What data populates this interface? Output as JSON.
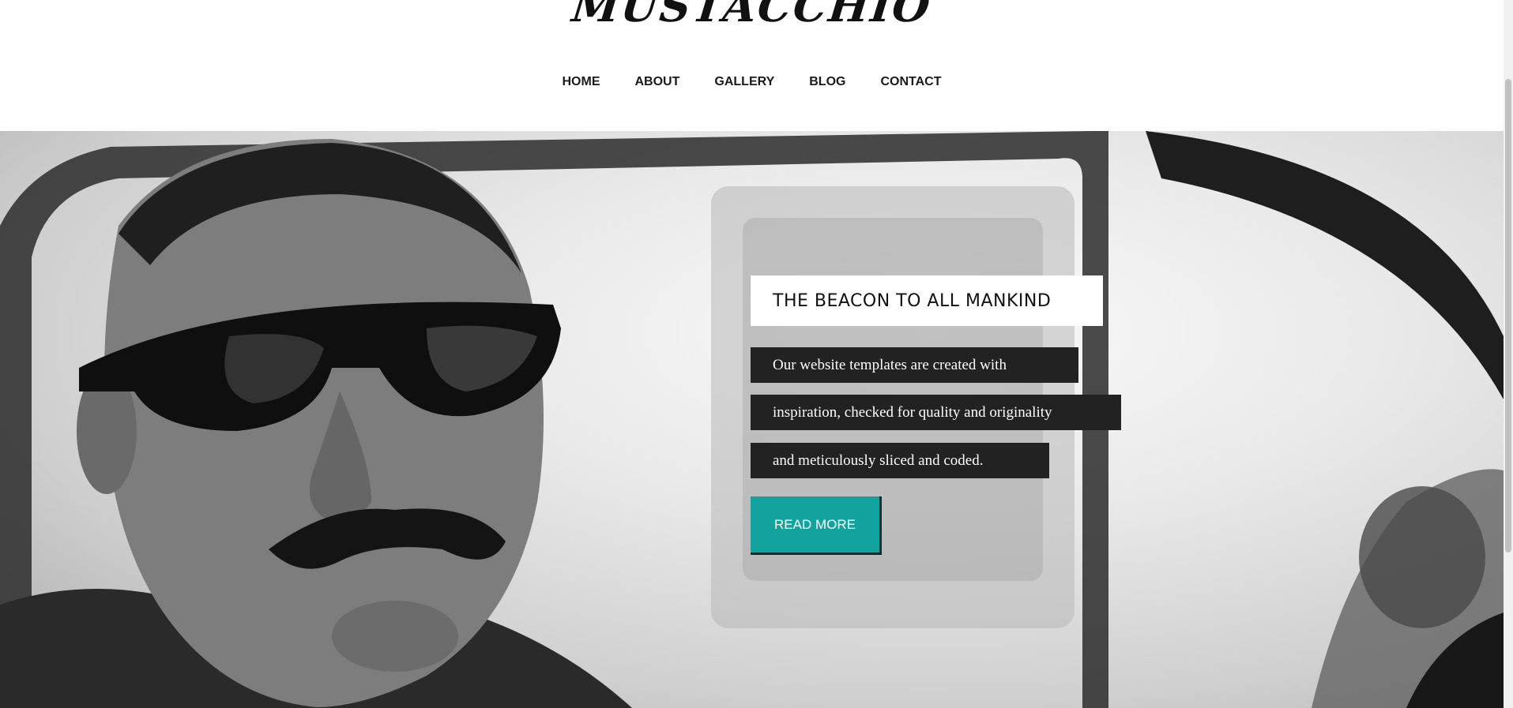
{
  "header": {
    "logo_text": "MUSTACCHIO",
    "nav": [
      {
        "label": "HOME"
      },
      {
        "label": "ABOUT"
      },
      {
        "label": "GALLERY"
      },
      {
        "label": "BLOG"
      },
      {
        "label": "CONTACT"
      }
    ]
  },
  "hero": {
    "title": "THE BEACON TO ALL MANKIND",
    "lines": [
      "Our website templates are created with",
      "inspiration, checked for quality and originality",
      "and meticulously sliced and coded."
    ],
    "button_label": "READ MORE"
  },
  "colors": {
    "accent": "#12a39f",
    "caption_bg": "#222222",
    "title_bg": "#ffffff"
  }
}
